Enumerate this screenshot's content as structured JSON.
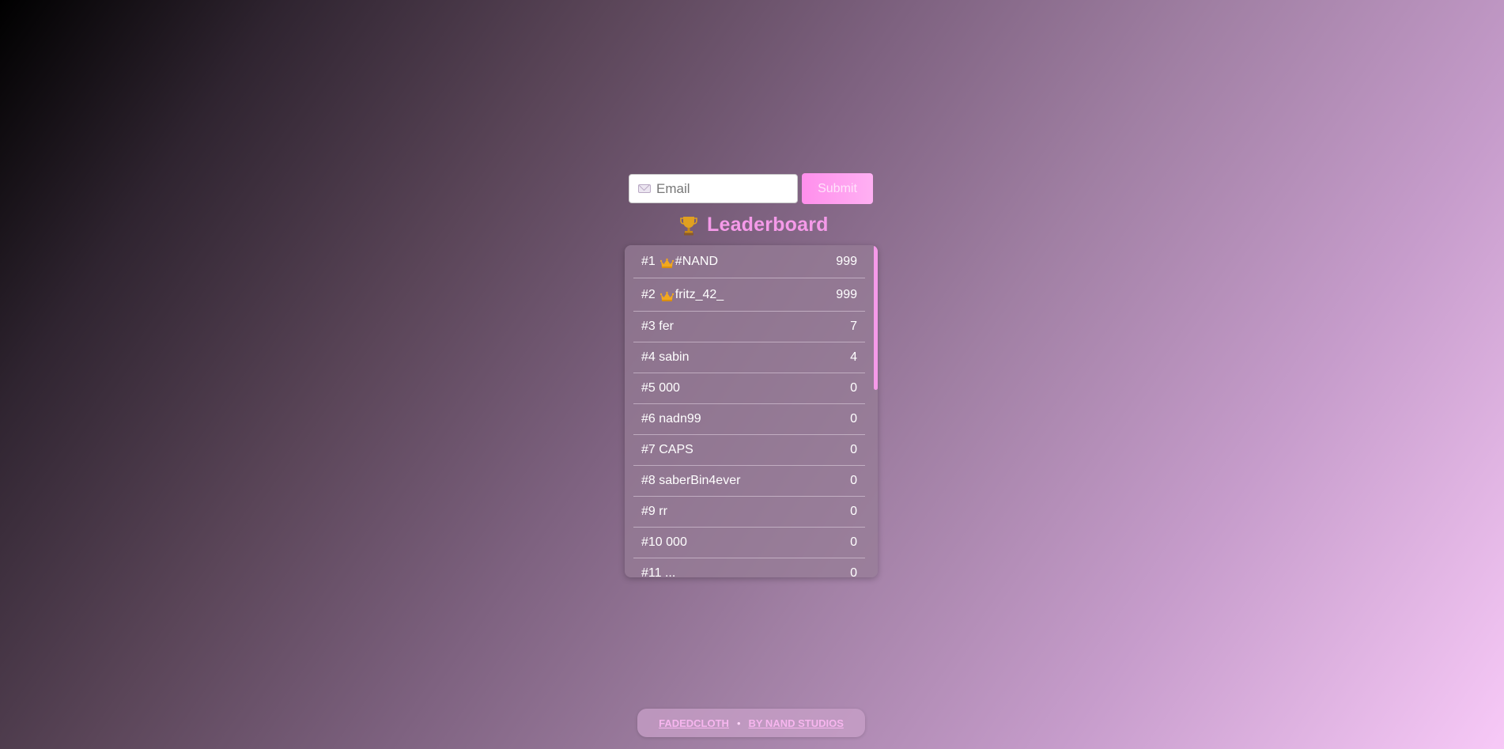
{
  "form": {
    "email_placeholder": "Email",
    "submit_label": "Submit"
  },
  "leaderboard": {
    "title": "Leaderboard",
    "entries": [
      {
        "rank": "#1",
        "name": "#NAND",
        "score": "999",
        "crown": true
      },
      {
        "rank": "#2",
        "name": "fritz_42_",
        "score": "999",
        "crown": true
      },
      {
        "rank": "#3",
        "name": "fer",
        "score": "7",
        "crown": false
      },
      {
        "rank": "#4",
        "name": "sabin",
        "score": "4",
        "crown": false
      },
      {
        "rank": "#5",
        "name": "000",
        "score": "0",
        "crown": false
      },
      {
        "rank": "#6",
        "name": "nadn99",
        "score": "0",
        "crown": false
      },
      {
        "rank": "#7",
        "name": "CAPS",
        "score": "0",
        "crown": false
      },
      {
        "rank": "#8",
        "name": "saberBin4ever",
        "score": "0",
        "crown": false
      },
      {
        "rank": "#9",
        "name": "rr",
        "score": "0",
        "crown": false
      },
      {
        "rank": "#10",
        "name": "000",
        "score": "0",
        "crown": false
      },
      {
        "rank": "#11",
        "name": "...",
        "score": "0",
        "crown": false
      }
    ]
  },
  "footer": {
    "brand_link": "FADEDCLOTH",
    "separator": "•",
    "studio_link": "BY NAND STUDIOS"
  },
  "colors": {
    "accent": "#f59ae9",
    "submit_gradient_start": "#ff8fec",
    "submit_gradient_end": "#ffb0f3"
  }
}
